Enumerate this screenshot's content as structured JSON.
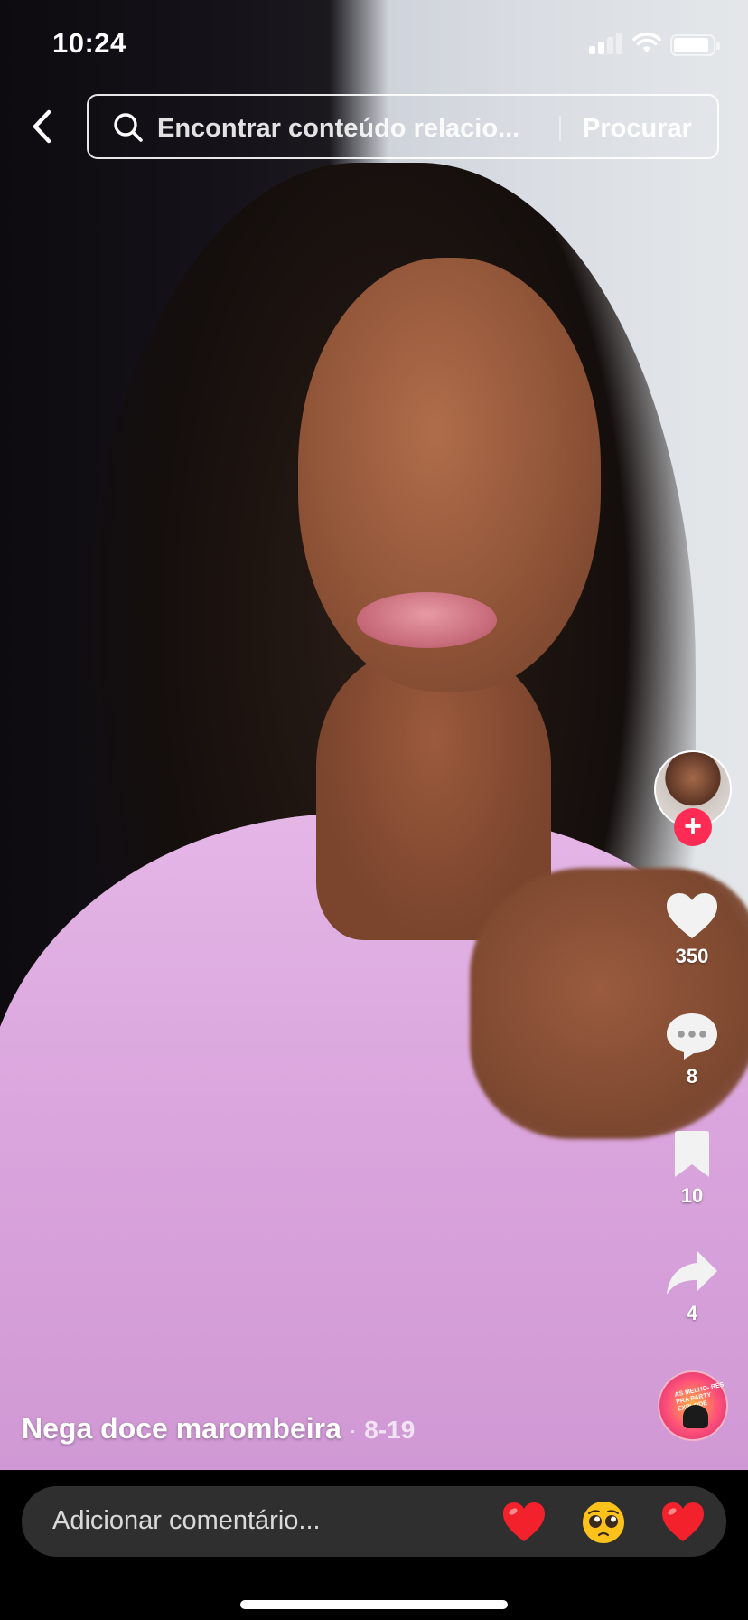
{
  "status_bar": {
    "time": "10:24"
  },
  "search": {
    "placeholder": "Encontrar conteúdo relacio...",
    "button_label": "Procurar"
  },
  "actions": {
    "likes": "350",
    "comments": "8",
    "saves": "10",
    "shares": "4"
  },
  "post": {
    "author": "Nega doce marombeira",
    "separator": "·",
    "date": "8-19"
  },
  "music_disc": {
    "text": "AS MELHO- RES PRA PARTY EXPLODE"
  },
  "comment_bar": {
    "placeholder": "Adicionar comentário...",
    "quick_emojis": [
      "heart",
      "pleading-face",
      "heart"
    ]
  },
  "colors": {
    "accent": "#fe2c55",
    "comment_bar_bg": "#2f2f2f",
    "shirt": "#dca7df"
  }
}
